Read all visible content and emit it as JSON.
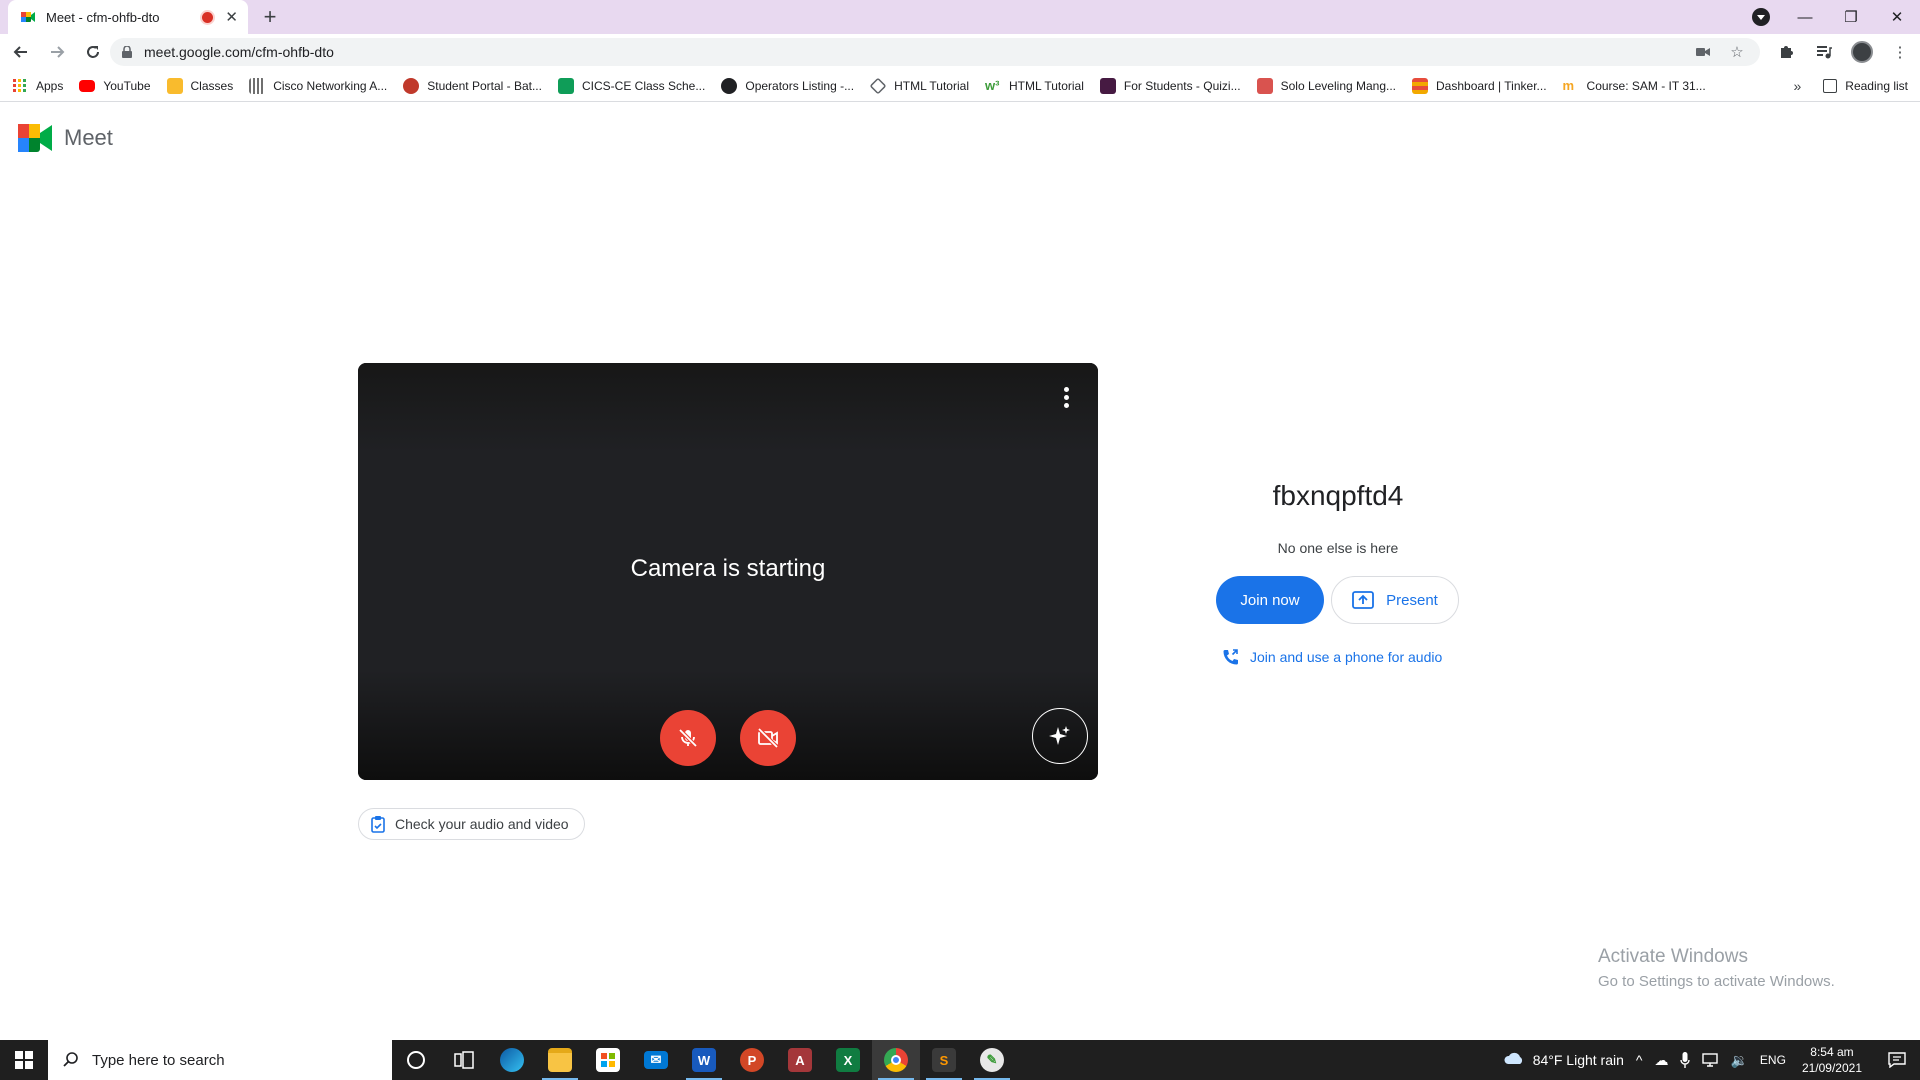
{
  "browser": {
    "tab_title": "Meet - cfm-ohfb-dto",
    "url": "meet.google.com/cfm-ohfb-dto",
    "bookmarks": [
      {
        "label": "Apps",
        "color": "#e94235"
      },
      {
        "label": "YouTube",
        "color": "#ff0000"
      },
      {
        "label": "Classes",
        "color": "#f9bb2d"
      },
      {
        "label": "Cisco Networking A...",
        "color": "#6f6f6f"
      },
      {
        "label": "Student Portal - Bat...",
        "color": "#c0392b"
      },
      {
        "label": "CICS-CE Class Sche...",
        "color": "#0f9d58"
      },
      {
        "label": "Operators Listing -...",
        "color": "#202124"
      },
      {
        "label": "HTML Tutorial",
        "color": "#5f6368"
      },
      {
        "label": "HTML Tutorial",
        "color": "#3d9c3a"
      },
      {
        "label": "For Students - Quizi...",
        "color": "#461a42"
      },
      {
        "label": "Solo Leveling Mang...",
        "color": "#d9534f"
      },
      {
        "label": "Dashboard | Tinker...",
        "color": "#f2a900"
      },
      {
        "label": "Course: SAM - IT 31...",
        "color": "#f5a623"
      }
    ],
    "reading_list": "Reading list"
  },
  "meet": {
    "brand": "Meet",
    "camera_status": "Camera is starting",
    "check_av": "Check your audio and video",
    "meeting_name": "fbxnqpftd4",
    "presence": "No one else is here",
    "join_label": "Join now",
    "present_label": "Present",
    "phone_label": "Join and use a phone for audio",
    "accent": "#1a73e8",
    "danger": "#ea4335"
  },
  "watermark": {
    "line1": "Activate Windows",
    "line2": "Go to Settings to activate Windows."
  },
  "taskbar": {
    "search_placeholder": "Type here to search",
    "weather": "84°F  Light rain",
    "language": "ENG",
    "time": "8:54 am",
    "date": "21/09/2021"
  }
}
